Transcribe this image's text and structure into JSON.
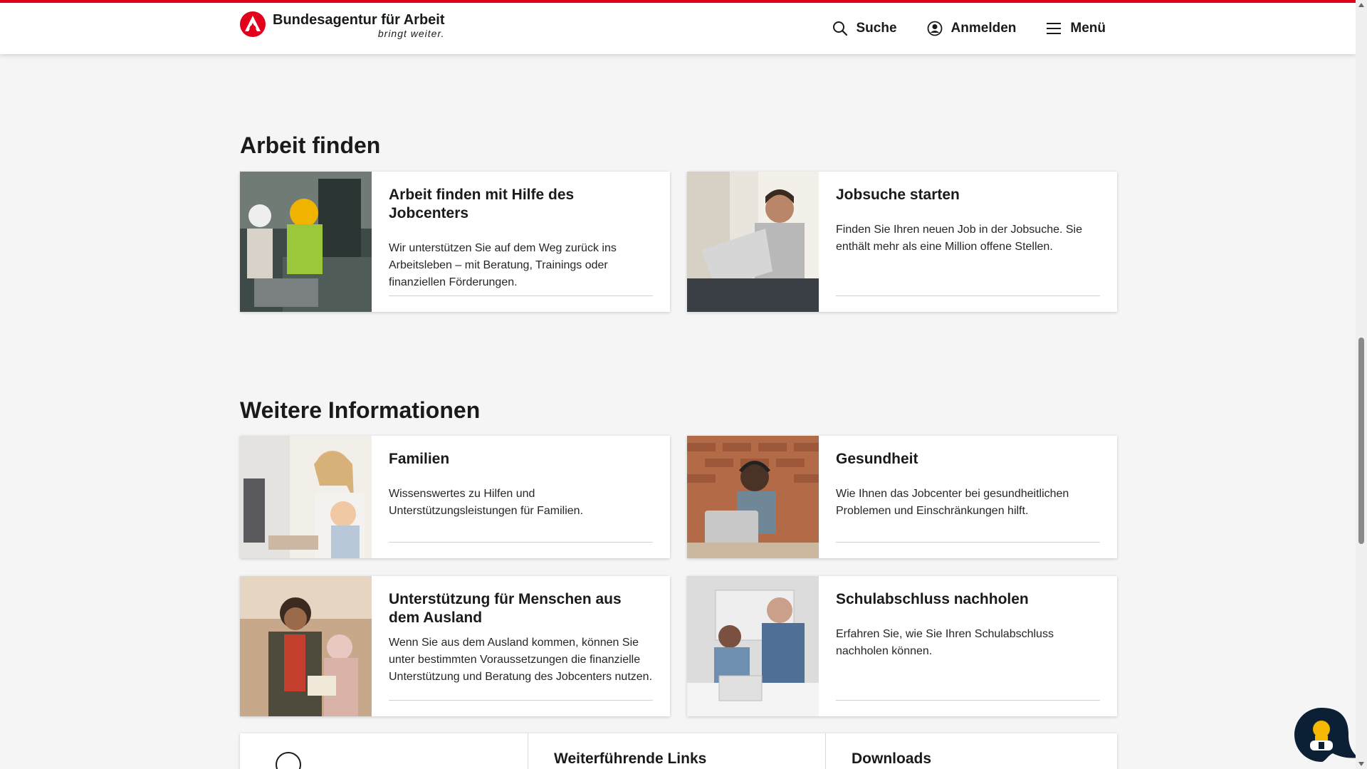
{
  "header": {
    "brand_name": "Bundesagentur für Arbeit",
    "brand_tagline": "bringt weiter.",
    "nav": {
      "search_label": "Suche",
      "login_label": "Anmelden",
      "menu_label": "Menü"
    }
  },
  "colors": {
    "brand_red": "#e2001a",
    "text_dark": "#1a1a1a",
    "chat_navy": "#0b1f35",
    "chat_yellow": "#f5b800"
  },
  "sections": {
    "work": {
      "title": "Arbeit finden",
      "cards": [
        {
          "title": "Arbeit finden mit Hilfe des Jobcenters",
          "text": "Wir unterstützen Sie auf dem Weg zurück ins Arbeitsleben – mit Beratung, Trainings oder finanziellen Förderungen."
        },
        {
          "title": "Jobsuche starten",
          "text": "Finden Sie Ihren neuen Job in der Jobsuche. Sie enthält mehr als eine Million offene Stellen."
        }
      ]
    },
    "info": {
      "title": "Weitere Informationen",
      "cards": [
        {
          "title": "Familien",
          "text": "Wissenswertes zu Hilfen und Unterstützungsleistungen für Familien."
        },
        {
          "title": "Gesundheit",
          "text": "Wie Ihnen das Jobcenter bei gesundheitlichen Problemen und Einschränkungen hilft."
        },
        {
          "title": "Unterstützung für Menschen aus dem Ausland",
          "text": "Wenn Sie aus dem Ausland kommen, können Sie unter bestimmten Voraussetzungen die finanzielle Unterstützung und Beratung des Jobcenters nutzen."
        },
        {
          "title": "Schulabschluss nachholen",
          "text": "Erfahren Sie, wie Sie Ihren Schulabschluss nachholen können."
        }
      ]
    }
  },
  "bottom": {
    "links_label": "Weiterführende Links",
    "downloads_label": "Downloads"
  }
}
